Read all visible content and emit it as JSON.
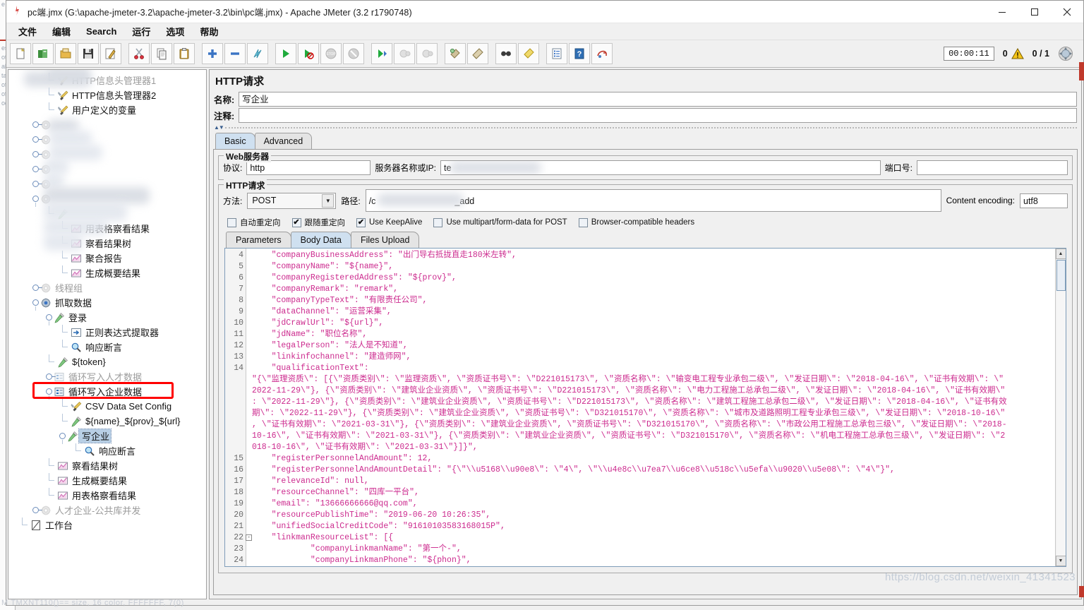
{
  "window": {
    "title": "pc端.jmx (G:\\apache-jmeter-3.2\\apache-jmeter-3.2\\bin\\pc端.jmx) - Apache JMeter (3.2 r1790748)",
    "minimize": "—",
    "maximize": "□",
    "close": "✕"
  },
  "menu": {
    "items": [
      {
        "label": "文件"
      },
      {
        "label": "编辑"
      },
      {
        "label": "Search"
      },
      {
        "label": "运行"
      },
      {
        "label": "选项"
      },
      {
        "label": "帮助"
      }
    ]
  },
  "toolbar": {
    "buttons": [
      {
        "name": "new-icon",
        "title": "New"
      },
      {
        "name": "templates-icon",
        "title": "Templates"
      },
      {
        "name": "open-icon",
        "title": "Open"
      },
      {
        "name": "save-icon",
        "title": "Save"
      },
      {
        "name": "save-as-icon",
        "title": "Save As"
      },
      {
        "name": "cut-icon",
        "title": "Cut"
      },
      {
        "name": "copy-icon",
        "title": "Copy"
      },
      {
        "name": "paste-icon",
        "title": "Paste"
      },
      {
        "name": "expand-all-icon",
        "title": "Expand All"
      },
      {
        "name": "collapse-all-icon",
        "title": "Collapse All"
      },
      {
        "name": "toggle-icon",
        "title": "Toggle"
      },
      {
        "name": "start-icon",
        "title": "Start"
      },
      {
        "name": "start-no-timers-icon",
        "title": "Start no pauses"
      },
      {
        "name": "stop-icon",
        "title": "Stop"
      },
      {
        "name": "shutdown-icon",
        "title": "Shutdown"
      },
      {
        "name": "start-remote-icon",
        "title": "Remote Start All"
      },
      {
        "name": "stop-remote-icon",
        "title": "Remote Stop All"
      },
      {
        "name": "shutdown-remote-icon",
        "title": "Remote Shutdown All"
      },
      {
        "name": "clear-icon",
        "title": "Clear"
      },
      {
        "name": "clear-all-icon",
        "title": "Clear All"
      },
      {
        "name": "search-icon",
        "title": "Search"
      },
      {
        "name": "search-reset-icon",
        "title": "Reset Search"
      },
      {
        "name": "function-helper-icon",
        "title": "Function Helper Dialog"
      },
      {
        "name": "help-icon",
        "title": "Help"
      },
      {
        "name": "undo-redo-icon",
        "title": "Undo"
      }
    ],
    "elapsed_time": "00:00:11",
    "warning_count": "0",
    "thread_count": "0 / 1"
  },
  "tree": {
    "nodes": [
      {
        "label": "HTTP信息头管理器1",
        "icon": "header-manager-icon",
        "state": "dim",
        "indent": 2,
        "connector": "elbow"
      },
      {
        "label": "HTTP信息头管理器2",
        "icon": "header-manager-icon",
        "state": "normal",
        "indent": 2,
        "connector": "elbow"
      },
      {
        "label": "用户定义的变量",
        "icon": "header-manager-icon",
        "state": "normal",
        "indent": 2,
        "connector": "elbow"
      },
      {
        "label": "",
        "icon": "thread-group-icon",
        "state": "blurred",
        "indent": 1,
        "connector": "knob-closed"
      },
      {
        "label": "",
        "icon": "thread-group-icon",
        "state": "blurred",
        "indent": 1,
        "connector": "knob-closed"
      },
      {
        "label": "",
        "icon": "thread-group-icon",
        "state": "blurred",
        "indent": 1,
        "connector": "knob-closed"
      },
      {
        "label": "",
        "icon": "thread-group-icon",
        "state": "blurred",
        "indent": 1,
        "connector": "knob-closed"
      },
      {
        "label": "",
        "icon": "thread-group-icon",
        "state": "blurred",
        "indent": 1,
        "connector": "knob-closed"
      },
      {
        "label": "",
        "icon": "thread-group-icon",
        "state": "blurred",
        "indent": 1,
        "connector": "knob-open"
      },
      {
        "label": "",
        "icon": "sampler-icon",
        "state": "blurred",
        "indent": 2,
        "connector": "elbow"
      },
      {
        "label": "用表格察看结果",
        "icon": "listener-icon",
        "state": "normal",
        "indent": 3,
        "connector": "elbow"
      },
      {
        "label": "察看结果树",
        "icon": "listener-icon",
        "state": "normal",
        "indent": 3,
        "connector": "elbow"
      },
      {
        "label": "聚合报告",
        "icon": "listener-icon",
        "state": "normal",
        "indent": 3,
        "connector": "elbow"
      },
      {
        "label": "生成概要结果",
        "icon": "listener-icon",
        "state": "normal",
        "indent": 3,
        "connector": "elbow"
      },
      {
        "label": "线程组",
        "icon": "thread-group-icon",
        "state": "dim",
        "indent": 1,
        "connector": "knob-closed"
      },
      {
        "label": "抓取数据",
        "icon": "thread-group-active-icon",
        "state": "normal",
        "indent": 1,
        "connector": "knob-open"
      },
      {
        "label": "登录",
        "icon": "sampler-icon",
        "state": "normal",
        "indent": 2,
        "connector": "knob-open"
      },
      {
        "label": "正则表达式提取器",
        "icon": "post-processor-icon",
        "state": "normal",
        "indent": 3,
        "connector": "elbow"
      },
      {
        "label": "响应断言",
        "icon": "assertion-icon",
        "state": "normal",
        "indent": 3,
        "connector": "elbow-last"
      },
      {
        "label": "${token}",
        "icon": "sampler-icon",
        "state": "normal",
        "indent": 2,
        "connector": "elbow"
      },
      {
        "label": "循环写入人才数据",
        "icon": "controller-icon",
        "state": "dim",
        "indent": 2,
        "connector": "knob-closed"
      },
      {
        "label": "循环写入企业数据",
        "icon": "controller-icon",
        "state": "normal",
        "indent": 2,
        "connector": "knob-open",
        "boxed": true
      },
      {
        "label": "CSV Data Set Config",
        "icon": "config-icon",
        "state": "normal",
        "indent": 3,
        "connector": "elbow"
      },
      {
        "label": "${name}_${prov}_${url}",
        "icon": "sampler-icon",
        "state": "normal",
        "indent": 3,
        "connector": "elbow"
      },
      {
        "label": "写企业",
        "icon": "sampler-icon",
        "state": "selected",
        "indent": 3,
        "connector": "knob-open"
      },
      {
        "label": "响应断言",
        "icon": "assertion-icon",
        "state": "normal",
        "indent": 4,
        "connector": "elbow-last"
      },
      {
        "label": "察看结果树",
        "icon": "listener-icon",
        "state": "normal",
        "indent": 2,
        "connector": "elbow"
      },
      {
        "label": "生成概要结果",
        "icon": "listener-icon",
        "state": "normal",
        "indent": 2,
        "connector": "elbow"
      },
      {
        "label": "用表格察看结果",
        "icon": "listener-icon",
        "state": "normal",
        "indent": 2,
        "connector": "elbow-last"
      },
      {
        "label": "人才企业-公共库并发",
        "icon": "thread-group-icon",
        "state": "dim",
        "indent": 1,
        "connector": "knob-closed"
      },
      {
        "label": "工作台",
        "icon": "workbench-icon",
        "state": "normal",
        "indent": 0,
        "connector": "elbow-last"
      }
    ]
  },
  "request": {
    "panel_title": "HTTP请求",
    "name_label": "名称:",
    "name_value": "写企业",
    "comment_label": "注释:",
    "comment_value": "",
    "tabs": [
      {
        "label": "Basic",
        "active": true
      },
      {
        "label": "Advanced",
        "active": false
      }
    ],
    "web_server": {
      "group_title": "Web服务器",
      "protocol_label": "协议:",
      "protocol_value": "http",
      "server_label": "服务器名称或IP:",
      "server_value": "te",
      "port_label": "端口号:",
      "port_value": ""
    },
    "http_request": {
      "group_title": "HTTP请求",
      "method_label": "方法:",
      "method_value": "POST",
      "path_label": "路径:",
      "path_value": "/c",
      "path_suffix": "_add",
      "encoding_label": "Content encoding:",
      "encoding_value": "utf8",
      "checkboxes": [
        {
          "label": "自动重定向",
          "checked": false
        },
        {
          "label": "跟随重定向",
          "checked": true
        },
        {
          "label": "Use KeepAlive",
          "checked": true
        },
        {
          "label": "Use multipart/form-data for POST",
          "checked": false
        },
        {
          "label": "Browser-compatible headers",
          "checked": false
        }
      ]
    },
    "data_tabs": [
      {
        "label": "Parameters",
        "active": false
      },
      {
        "label": "Body Data",
        "active": true
      },
      {
        "label": "Files Upload",
        "active": false
      }
    ]
  },
  "body_editor": {
    "lines": [
      {
        "no": "4",
        "text": "    \"companyBusinessAddress\": \"出门导右抵拢直走180米左转\","
      },
      {
        "no": "5",
        "text": "    \"companyName\": \"${name}\","
      },
      {
        "no": "6",
        "text": "    \"companyRegisteredAddress\": \"${prov}\","
      },
      {
        "no": "7",
        "text": "    \"companyRemark\": \"remark\","
      },
      {
        "no": "8",
        "text": "    \"companyTypeText\": \"有限责任公司\","
      },
      {
        "no": "9",
        "text": "    \"dataChannel\": \"运营采集\","
      },
      {
        "no": "10",
        "text": "    \"jdCrawlUrl\": \"${url}\","
      },
      {
        "no": "11",
        "text": "    \"jdName\": \"职位名称\","
      },
      {
        "no": "12",
        "text": "    \"legalPerson\": \"法人是不知道\","
      },
      {
        "no": "13",
        "text": "    \"linkinfochannel\": \"建造师网\","
      },
      {
        "no": "14",
        "text": "    \"qualificationText\":"
      }
    ],
    "qualification_wrapped": [
      "\"{\\\"监理资质\\\": [{\\\"资质类别\\\": \\\"监理资质\\\", \\\"资质证书号\\\": \\\"D221015173\\\", \\\"资质名称\\\": \\\"输变电工程专业承包二级\\\", \\\"发证日期\\\": \\\"2018-04-16\\\", \\\"证书有效期\\\": \\\"",
      "2022-11-29\\\"}, {\\\"资质类别\\\": \\\"建筑业企业资质\\\", \\\"资质证书号\\\": \\\"D221015173\\\", \\\"资质名称\\\": \\\"电力工程施工总承包二级\\\", \\\"发证日期\\\": \\\"2018-04-16\\\", \\\"证书有效期\\\"",
      ": \\\"2022-11-29\\\"}, {\\\"资质类别\\\": \\\"建筑业企业资质\\\", \\\"资质证书号\\\": \\\"D221015173\\\", \\\"资质名称\\\": \\\"建筑工程施工总承包二级\\\", \\\"发证日期\\\": \\\"2018-04-16\\\", \\\"证书有效",
      "期\\\": \\\"2022-11-29\\\"}, {\\\"资质类别\\\": \\\"建筑业企业资质\\\", \\\"资质证书号\\\": \\\"D321015170\\\", \\\"资质名称\\\": \\\"城市及道路照明工程专业承包三级\\\", \\\"发证日期\\\": \\\"2018-10-16\\\"",
      ", \\\"证书有效期\\\": \\\"2021-03-31\\\"}, {\\\"资质类别\\\": \\\"建筑业企业资质\\\", \\\"资质证书号\\\": \\\"D321015170\\\", \\\"资质名称\\\": \\\"市政公用工程施工总承包三级\\\", \\\"发证日期\\\": \\\"2018-",
      "10-16\\\", \\\"证书有效期\\\": \\\"2021-03-31\\\"}, {\\\"资质类别\\\": \\\"建筑业企业资质\\\", \\\"资质证书号\\\": \\\"D321015170\\\", \\\"资质名称\\\": \\\"机电工程施工总承包三级\\\", \\\"发证日期\\\": \\\"2",
      "018-10-16\\\", \\\"证书有效期\\\": \\\"2021-03-31\\\"}]}\","
    ],
    "lines_after": [
      {
        "no": "15",
        "text": "    \"registerPersonnelAndAmount\": 12,"
      },
      {
        "no": "16",
        "text": "    \"registerPersonnelAndAmountDetail\": \"{\\\"\\\\u5168\\\\u90e8\\\": \\\"4\\\", \\\"\\\\u4e8c\\\\u7ea7\\\\u6ce8\\\\u518c\\\\u5efa\\\\u9020\\\\u5e08\\\": \\\"4\\\"}\","
      },
      {
        "no": "17",
        "text": "    \"relevanceId\": null,"
      },
      {
        "no": "18",
        "text": "    \"resourceChannel\": \"四库一平台\","
      },
      {
        "no": "19",
        "text": "    \"email\": \"13666666666@qq.com\","
      },
      {
        "no": "20",
        "text": "    \"resourcePublishTime\": \"2019-06-20 10:26:35\","
      },
      {
        "no": "21",
        "text": "    \"unifiedSocialCreditCode\": \"91610103583168015P\","
      },
      {
        "no": "22",
        "text": "    \"linkmanResourceList\": [{",
        "fold": "-"
      },
      {
        "no": "23",
        "text": "            \"companyLinkmanName\": \"第一个-\","
      },
      {
        "no": "24",
        "text": "            \"companyLinkmanPhone\": \"${phon}\","
      }
    ]
  },
  "footer": {
    "ghost_text": "M TMXNT110()== size, 16 color, FFFFFFF, 7(0)",
    "watermark": "https://blog.csdn.net/weixin_41341523"
  }
}
